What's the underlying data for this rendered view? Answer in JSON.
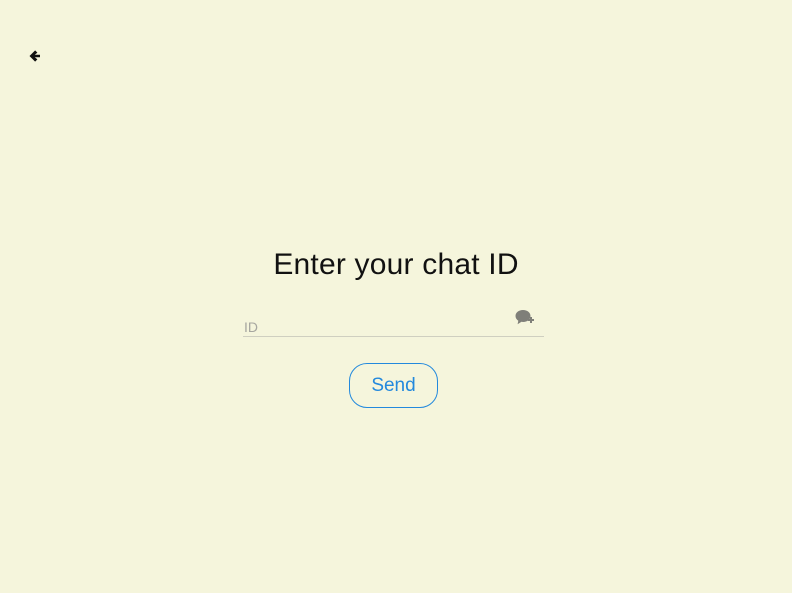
{
  "navigation": {
    "back_icon": "arrow-left-icon"
  },
  "form": {
    "title": "Enter your chat ID",
    "id_input": {
      "value": "",
      "placeholder": "ID"
    },
    "chat_add_icon": "chat-add-icon",
    "send_label": "Send"
  },
  "colors": {
    "background": "#f5f5dc",
    "text": "#111111",
    "placeholder": "#a7a7a0",
    "accent": "#2389dd",
    "icon": "#7f7f79",
    "divider": "#cfcfc0"
  }
}
